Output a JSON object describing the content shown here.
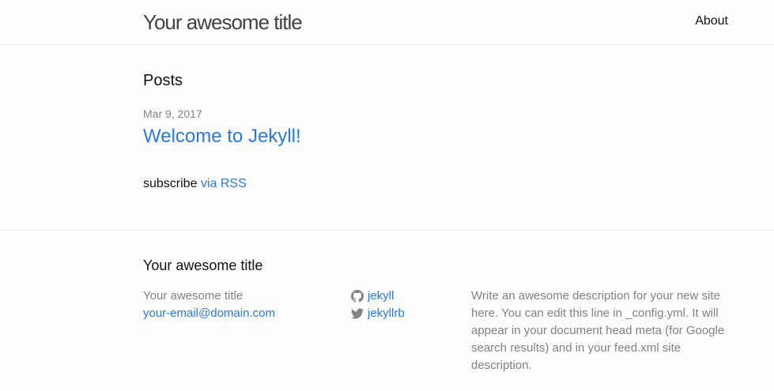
{
  "header": {
    "site_title": "Your awesome title",
    "nav": {
      "about": "About"
    }
  },
  "main": {
    "heading": "Posts",
    "posts": [
      {
        "date": "Mar 9, 2017",
        "title": "Welcome to Jekyll!"
      }
    ],
    "rss": {
      "prefix": "subscribe",
      "link": "via RSS"
    }
  },
  "footer": {
    "heading": "Your awesome title",
    "col1": {
      "name": "Your awesome title",
      "email": "your-email@domain.com"
    },
    "social": {
      "github": {
        "icon": "github-icon",
        "username": "jekyll"
      },
      "twitter": {
        "icon": "twitter-icon",
        "username": "jekyllrb"
      }
    },
    "description": "Write an awesome description for your new site here. You can edit this line in _config.yml. It will appear in your document head meta (for Google search results) and in your feed.xml site description."
  },
  "colors": {
    "link": "#2a7ae2",
    "muted": "#828282",
    "border": "#e8e8e8",
    "background": "#fdfdfd"
  }
}
